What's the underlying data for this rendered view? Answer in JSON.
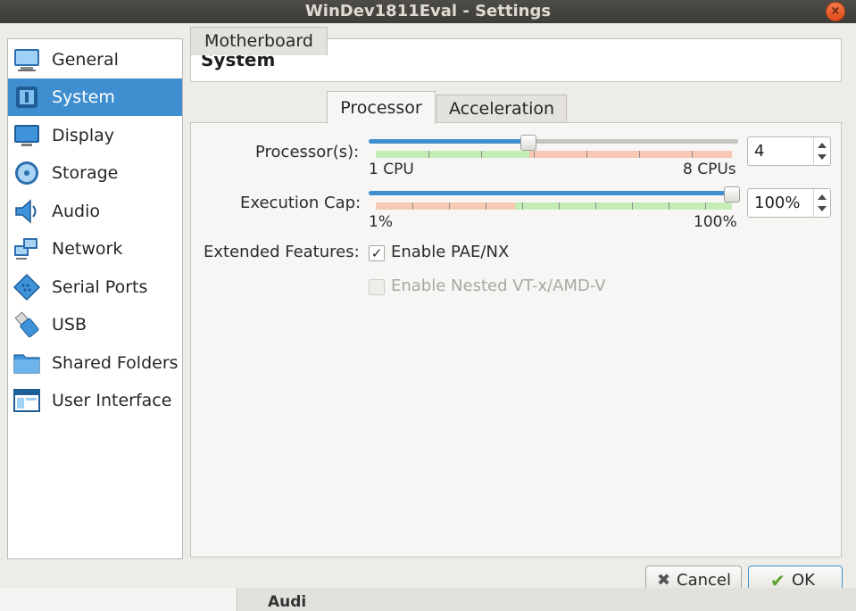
{
  "window": {
    "title": "WinDev1811Eval - Settings"
  },
  "sidebar": {
    "items": [
      {
        "label": "General",
        "icon": "monitor-icon"
      },
      {
        "label": "System",
        "icon": "chip-icon",
        "selected": true
      },
      {
        "label": "Display",
        "icon": "display-icon"
      },
      {
        "label": "Storage",
        "icon": "disk-icon"
      },
      {
        "label": "Audio",
        "icon": "speaker-icon"
      },
      {
        "label": "Network",
        "icon": "network-icon"
      },
      {
        "label": "Serial Ports",
        "icon": "serial-port-icon"
      },
      {
        "label": "USB",
        "icon": "usb-icon"
      },
      {
        "label": "Shared Folders",
        "icon": "folder-icon"
      },
      {
        "label": "User Interface",
        "icon": "window-icon"
      }
    ]
  },
  "header": {
    "title": "System"
  },
  "tabs": [
    {
      "label": "Motherboard"
    },
    {
      "label": "Processor",
      "active": true
    },
    {
      "label": "Acceleration"
    }
  ],
  "processor": {
    "count_label": "Processor(s):",
    "count_value": "4",
    "count_min": "1 CPU",
    "count_max": "8 CPUs",
    "count_fraction": 0.43,
    "cap_label": "Execution Cap:",
    "cap_value": "100%",
    "cap_min": "1%",
    "cap_max": "100%",
    "cap_fraction": 1.0,
    "extended_label": "Extended Features:",
    "pae_label": "Enable PAE/NX",
    "pae_checked": true,
    "nested_label": "Enable Nested VT-x/AMD-V",
    "nested_checked": false,
    "nested_enabled": false
  },
  "buttons": {
    "cancel": "Cancel",
    "ok": "OK"
  },
  "background_fragment": "Audi",
  "colors": {
    "accent": "#3f8fd0",
    "zone_green": "#c4ecb5",
    "zone_red": "#f7c8b4"
  }
}
